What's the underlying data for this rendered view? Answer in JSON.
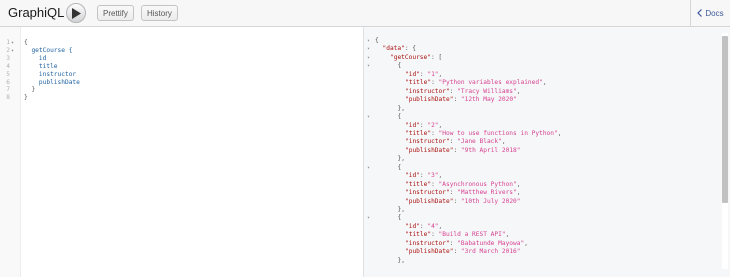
{
  "toolbar": {
    "logo": "GraphiQL",
    "prettify_label": "Prettify",
    "history_label": "History",
    "docs_label": "Docs"
  },
  "query_lines": [
    {
      "num": "1",
      "fold": "▾",
      "text": "{"
    },
    {
      "num": "2",
      "fold": "▾",
      "text": "  getCourse {"
    },
    {
      "num": "3",
      "fold": "",
      "text": "    id"
    },
    {
      "num": "4",
      "fold": "",
      "text": "    title"
    },
    {
      "num": "5",
      "fold": "",
      "text": "    instructor"
    },
    {
      "num": "6",
      "fold": "",
      "text": "    publishDate"
    },
    {
      "num": "7",
      "fold": "",
      "text": "  }"
    },
    {
      "num": "8",
      "fold": "",
      "text": "}"
    }
  ],
  "result": {
    "data_key": "\"data\"",
    "list_key": "\"getCourse\"",
    "courses": [
      {
        "id": "\"1\"",
        "title": "\"Python variables explained\"",
        "instructor": "\"Tracy Williams\"",
        "publishDate": "\"12th May 2020\""
      },
      {
        "id": "\"2\"",
        "title": "\"How to use functions in Python\"",
        "instructor": "\"Jane Black\"",
        "publishDate": "\"9th April 2018\""
      },
      {
        "id": "\"3\"",
        "title": "\"Asynchronous Python\"",
        "instructor": "\"Matthew Rivers\"",
        "publishDate": "\"10th July 2020\""
      },
      {
        "id": "\"4\"",
        "title": "\"Build a REST API\"",
        "instructor": "\"Babatunde Mayowa\"",
        "publishDate": "\"3rd March 2016\""
      }
    ]
  },
  "colors": {
    "key": "#aa1111",
    "string": "#d64292",
    "query_field": "#1f61a0"
  }
}
